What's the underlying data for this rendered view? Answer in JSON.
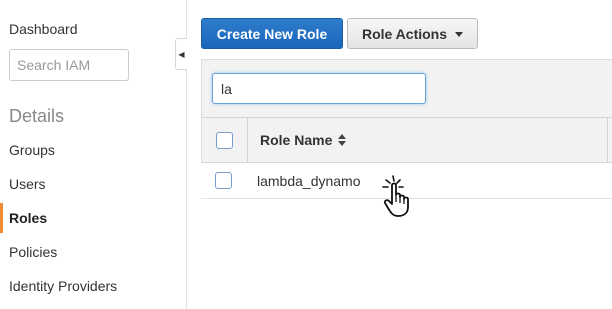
{
  "sidebar": {
    "dashboard_label": "Dashboard",
    "search_placeholder": "Search IAM",
    "section_title": "Details",
    "items": [
      {
        "label": "Groups"
      },
      {
        "label": "Users"
      },
      {
        "label": "Roles"
      },
      {
        "label": "Policies"
      },
      {
        "label": "Identity Providers"
      }
    ],
    "active_item": "Roles",
    "collapse_icon": "caret-left-icon"
  },
  "toolbar": {
    "create_label": "Create New Role",
    "actions_label": "Role Actions"
  },
  "filter": {
    "value": "la"
  },
  "table": {
    "columns": [
      "Role Name"
    ],
    "sort_icon": "sort-icon",
    "rows": [
      {
        "role_name": "lambda_dynamo"
      }
    ]
  },
  "colors": {
    "primary_button": "#1f6fc4",
    "active_accent": "#f08c2e"
  }
}
